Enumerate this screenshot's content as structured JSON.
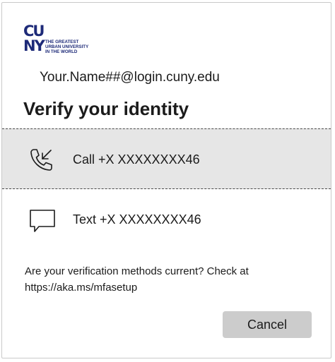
{
  "logo": {
    "letters": [
      "CU",
      "NY"
    ],
    "tagline": "THE GREATEST\nURBAN UNIVERSITY\nIN THE WORLD",
    "color": "#1d2a78"
  },
  "account": "Your.Name##@login.cuny.edu",
  "title": "Verify your identity",
  "methods": [
    {
      "icon": "phone-call-icon",
      "label": "Call +X XXXXXXXX46",
      "selected": true
    },
    {
      "icon": "text-message-icon",
      "label": "Text +X XXXXXXXX46",
      "selected": false
    }
  ],
  "info": {
    "line1": "Are your verification methods current? Check at",
    "line2": "https://aka.ms/mfasetup"
  },
  "cancel_label": "Cancel",
  "colors": {
    "selected_bg": "#e6e6e6",
    "button_bg": "#cccccc"
  }
}
